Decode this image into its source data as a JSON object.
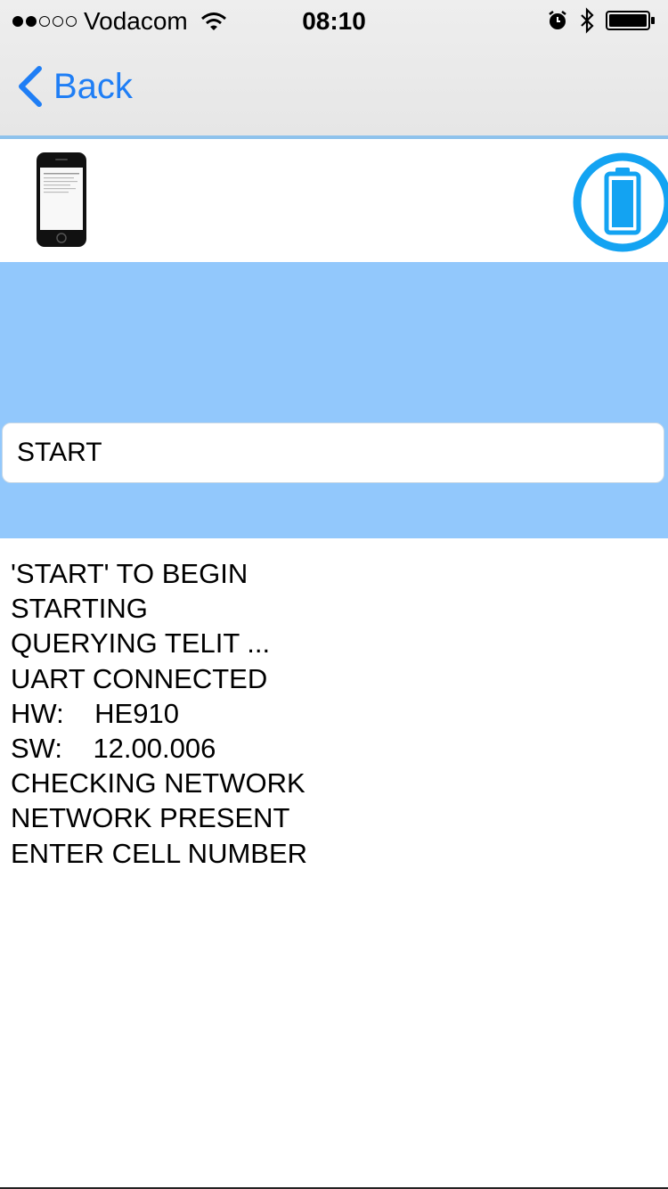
{
  "status_bar": {
    "signal_dots_filled": 2,
    "signal_dots_total": 5,
    "carrier": "Vodacom",
    "time": "08:10",
    "icons": [
      "wifi-icon",
      "alarm-icon",
      "bluetooth-icon",
      "battery-icon"
    ]
  },
  "nav": {
    "back_label": "Back"
  },
  "device_row": {
    "left_icon": "phone-icon",
    "right_icon": "battery-icon"
  },
  "command": {
    "value": "START"
  },
  "log": {
    "lines": [
      "'START' TO BEGIN",
      "STARTING",
      "QUERYING TELIT ...",
      "UART CONNECTED",
      "HW:    HE910",
      "SW:    12.00.006",
      "CHECKING NETWORK",
      "NETWORK PRESENT",
      "ENTER CELL NUMBER"
    ]
  },
  "colors": {
    "accent": "#1f7ef5",
    "panel_blue": "#92c8fc",
    "battery_blue": "#13a3f2"
  }
}
